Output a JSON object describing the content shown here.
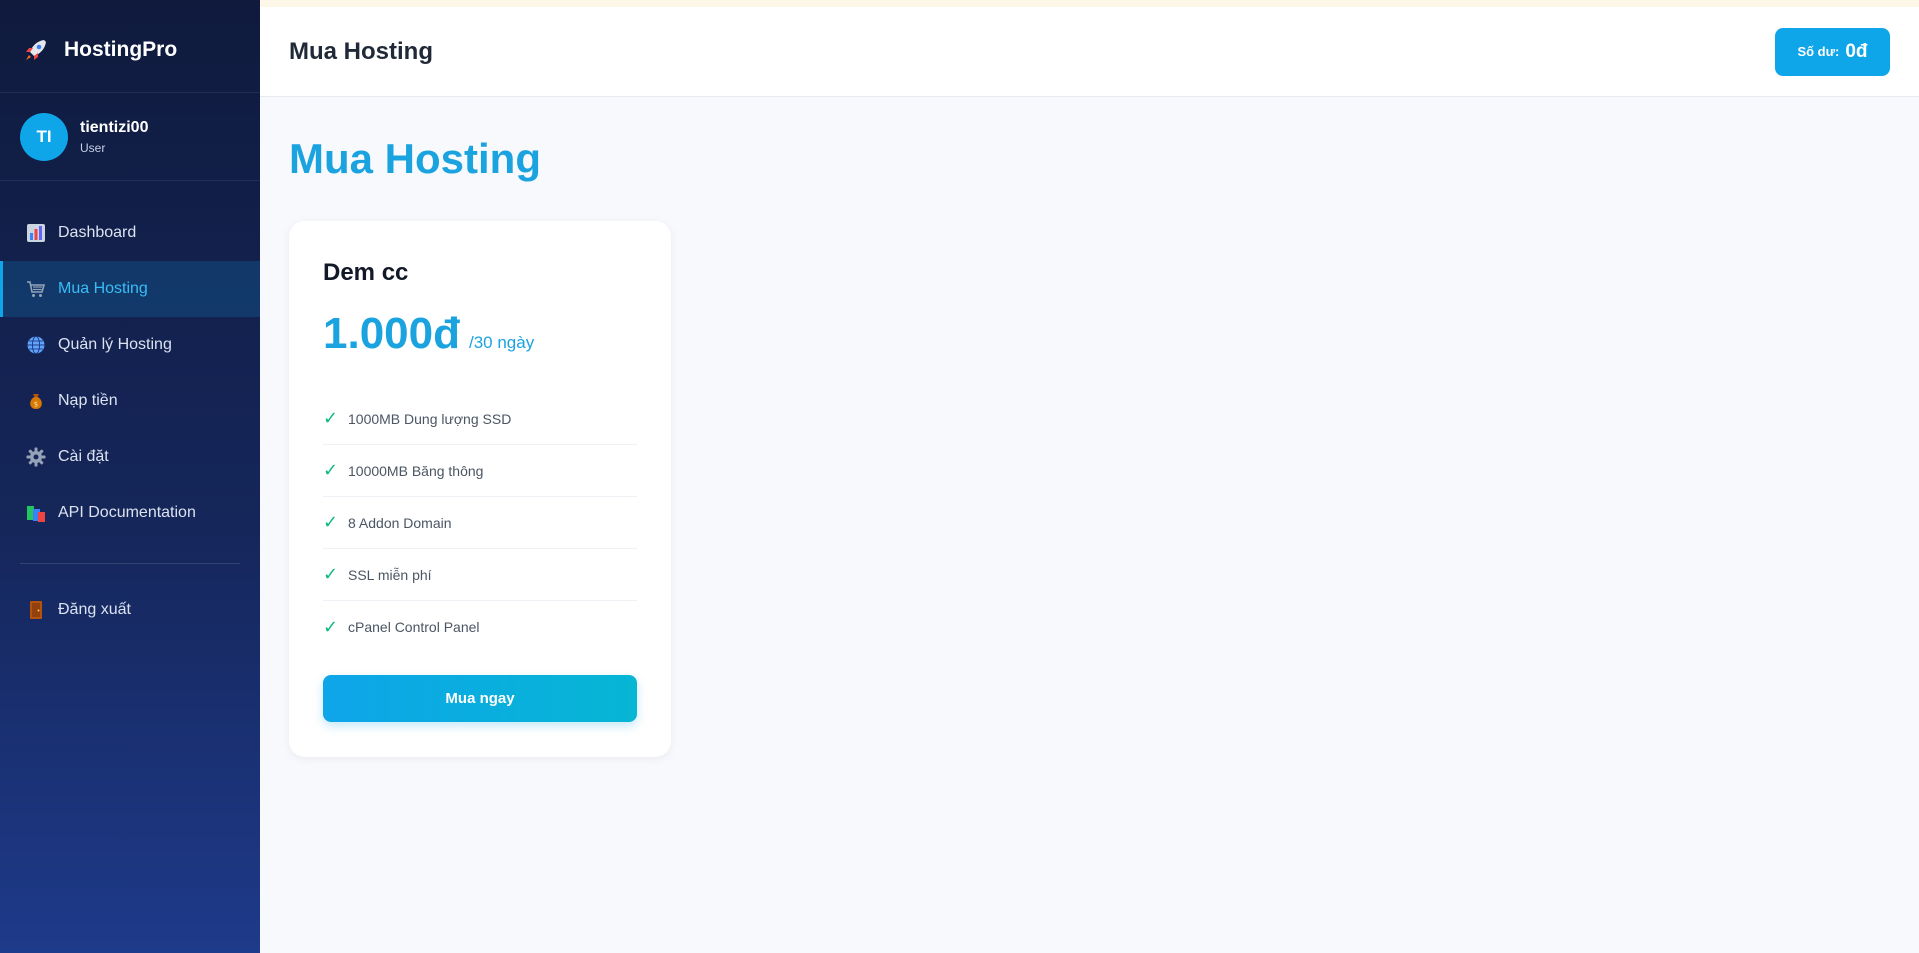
{
  "brand": {
    "name": "HostingPro",
    "icon": "rocket-icon"
  },
  "user": {
    "initials": "TI",
    "name": "tientizi00",
    "role": "User"
  },
  "sidebar": {
    "items": [
      {
        "label": "Dashboard",
        "icon": "chart-icon"
      },
      {
        "label": "Mua Hosting",
        "icon": "cart-icon",
        "active": true
      },
      {
        "label": "Quản lý Hosting",
        "icon": "globe-icon"
      },
      {
        "label": "Nạp tiền",
        "icon": "money-bag-icon"
      },
      {
        "label": "Cài đặt",
        "icon": "gear-icon"
      },
      {
        "label": "API Documentation",
        "icon": "books-icon"
      }
    ],
    "logout": {
      "label": "Đăng xuất",
      "icon": "door-icon"
    }
  },
  "header": {
    "title": "Mua Hosting",
    "balance_label": "Số dư:",
    "balance_value": "0đ"
  },
  "page": {
    "title": "Mua Hosting"
  },
  "plan": {
    "name": "Dem cc",
    "price": "1.000đ",
    "period": "/30 ngày",
    "features": [
      "1000MB Dung lượng SSD",
      "10000MB Băng thông",
      "8 Addon Domain",
      "SSL miễn phí",
      "cPanel Control Panel"
    ],
    "button_label": "Mua ngay"
  },
  "colors": {
    "accent": "#0ea5e9",
    "sidebar_bg": "#0f1a3d",
    "check": "#10b981"
  }
}
